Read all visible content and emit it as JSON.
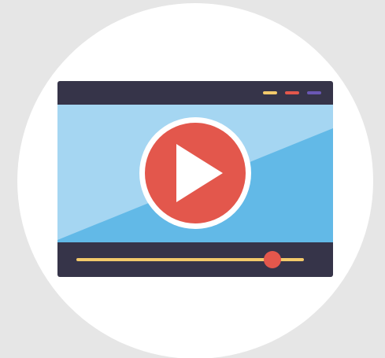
{
  "colors": {
    "background": "#e6e6e6",
    "circle": "#ffffff",
    "frame": "#363449",
    "screen_light": "#a5d6f2",
    "screen_dark": "#62b9e7",
    "play_red": "#e3574c",
    "play_ring": "#ffffff",
    "track": "#f2c96b",
    "thumb": "#e3574c",
    "dots": [
      "#f2c96b",
      "#e3574c",
      "#6a57b4"
    ]
  },
  "icons": {
    "play": "play-icon",
    "window_dots": [
      "yellow-dot-icon",
      "red-dot-icon",
      "purple-dot-icon"
    ]
  },
  "player": {
    "progress": 0.86
  }
}
